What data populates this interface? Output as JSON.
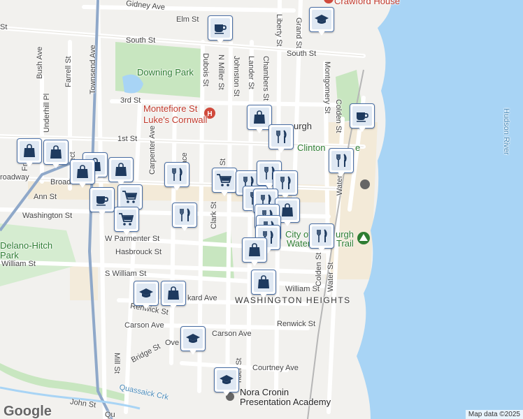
{
  "map": {
    "attribution": "Map data ©2025",
    "logo_text": "Google",
    "water_label": "Hudson River",
    "neighborhood": "WASHINGTON HEIGHTS",
    "parks": {
      "downing": "Downing Park",
      "delano_line1": "Delano-Hitch",
      "delano_line2": "Park"
    },
    "pois": {
      "hospital_line1": "Montefiore St",
      "hospital_line2": "Luke's Cornwall",
      "crawford": "Crawford House",
      "clinton": "Clinton",
      "clinton_tail": "e",
      "newburgh": "urgh",
      "waterfront_line1": "City of",
      "waterfront_line1b": "urgh",
      "waterfront_line2": "Water",
      "waterfront_line2b": "Trail",
      "school_line1": "Nora Cronin",
      "school_line2": "Presentation Academy"
    },
    "streets": {
      "gidney": "Gidney Ave",
      "elm": "Elm St",
      "south_st_left": "South St",
      "south_st_mid": "South St",
      "south_st_right": "South St",
      "third": "3rd St",
      "first": "1st St",
      "broadway": "Broadway",
      "broadway_left": "roadway",
      "ann": "Ann St",
      "washington": "Washington St",
      "parmenter": "W Parmenter St",
      "hasbrouck": "Hasbrouck St",
      "william": "William St",
      "s_william": "S William St",
      "william_right": "William St",
      "packard": "kard Ave",
      "renwick_left": "Renwick St",
      "renwick_right": "Renwick St",
      "carson_left": "Carson Ave",
      "carson_right": "Carson Ave",
      "bridge": "Bridge St",
      "ove": "Ove",
      "courtney": "Courtney Ave",
      "john": "John St",
      "quassaick": "Quassaick Crk",
      "mill": "Mill St",
      "bush": "Bush Ave",
      "farrell": "Farrell St",
      "townsend": "Townsend Ave",
      "underhill": "Underhill Pl",
      "carpenter": "Carpenter Ave",
      "terrace": "Terrace",
      "dubois": "Dubois St",
      "n_miller": "N Miller St",
      "johnston": "Johnston St",
      "lander": "Lander St",
      "chambers": "Chambers St",
      "liberty": "Liberty St",
      "grand": "Grand St",
      "montgomery": "Montgomery St",
      "colden_top": "Colden St",
      "colden_bottom": "Colden St",
      "water_top": "Water St",
      "water_bottom": "Water St",
      "clark": "Clark St",
      "fr": "Fr",
      "ect": "ect",
      "r_st": "r St",
      "lander_bottom": "nder St",
      "qu": "Qu",
      "st_left": "St"
    }
  },
  "markers": [
    {
      "icon": "coffee-cup"
    },
    {
      "icon": "graduation-cap"
    },
    {
      "icon": "shopping-bag"
    },
    {
      "icon": "coffee-cup"
    },
    {
      "icon": "fork-knife"
    },
    {
      "icon": "fork-knife"
    },
    {
      "icon": "shopping-bag"
    },
    {
      "icon": "shopping-bag"
    },
    {
      "icon": "shopping-bag"
    },
    {
      "icon": "shopping-bag"
    },
    {
      "icon": "shopping-bag"
    },
    {
      "icon": "coffee-cup"
    },
    {
      "icon": "shopping-cart"
    },
    {
      "icon": "shopping-cart"
    },
    {
      "icon": "fork-knife"
    },
    {
      "icon": "fork-knife"
    },
    {
      "icon": "shopping-cart"
    },
    {
      "icon": "fork-knife"
    },
    {
      "icon": "fork-knife"
    },
    {
      "icon": "fork-knife"
    },
    {
      "icon": "fork-knife"
    },
    {
      "icon": "fork-knife"
    },
    {
      "icon": "shopping-bag"
    },
    {
      "icon": "fork-knife"
    },
    {
      "icon": "fork-knife"
    },
    {
      "icon": "fork-knife"
    },
    {
      "icon": "shopping-bag"
    },
    {
      "icon": "fork-knife"
    },
    {
      "icon": "shopping-bag"
    },
    {
      "icon": "graduation-cap"
    },
    {
      "icon": "shopping-bag"
    },
    {
      "icon": "graduation-cap"
    },
    {
      "icon": "graduation-cap"
    }
  ],
  "colors": {
    "water": "#a8d4f5",
    "park": "#c8e6c0",
    "road": "#ffffff",
    "highway": "#8fa8c9",
    "marker_fill": "#dfe8f3",
    "marker_border": "#4a6fa5",
    "icon": "#1e3a5f"
  }
}
